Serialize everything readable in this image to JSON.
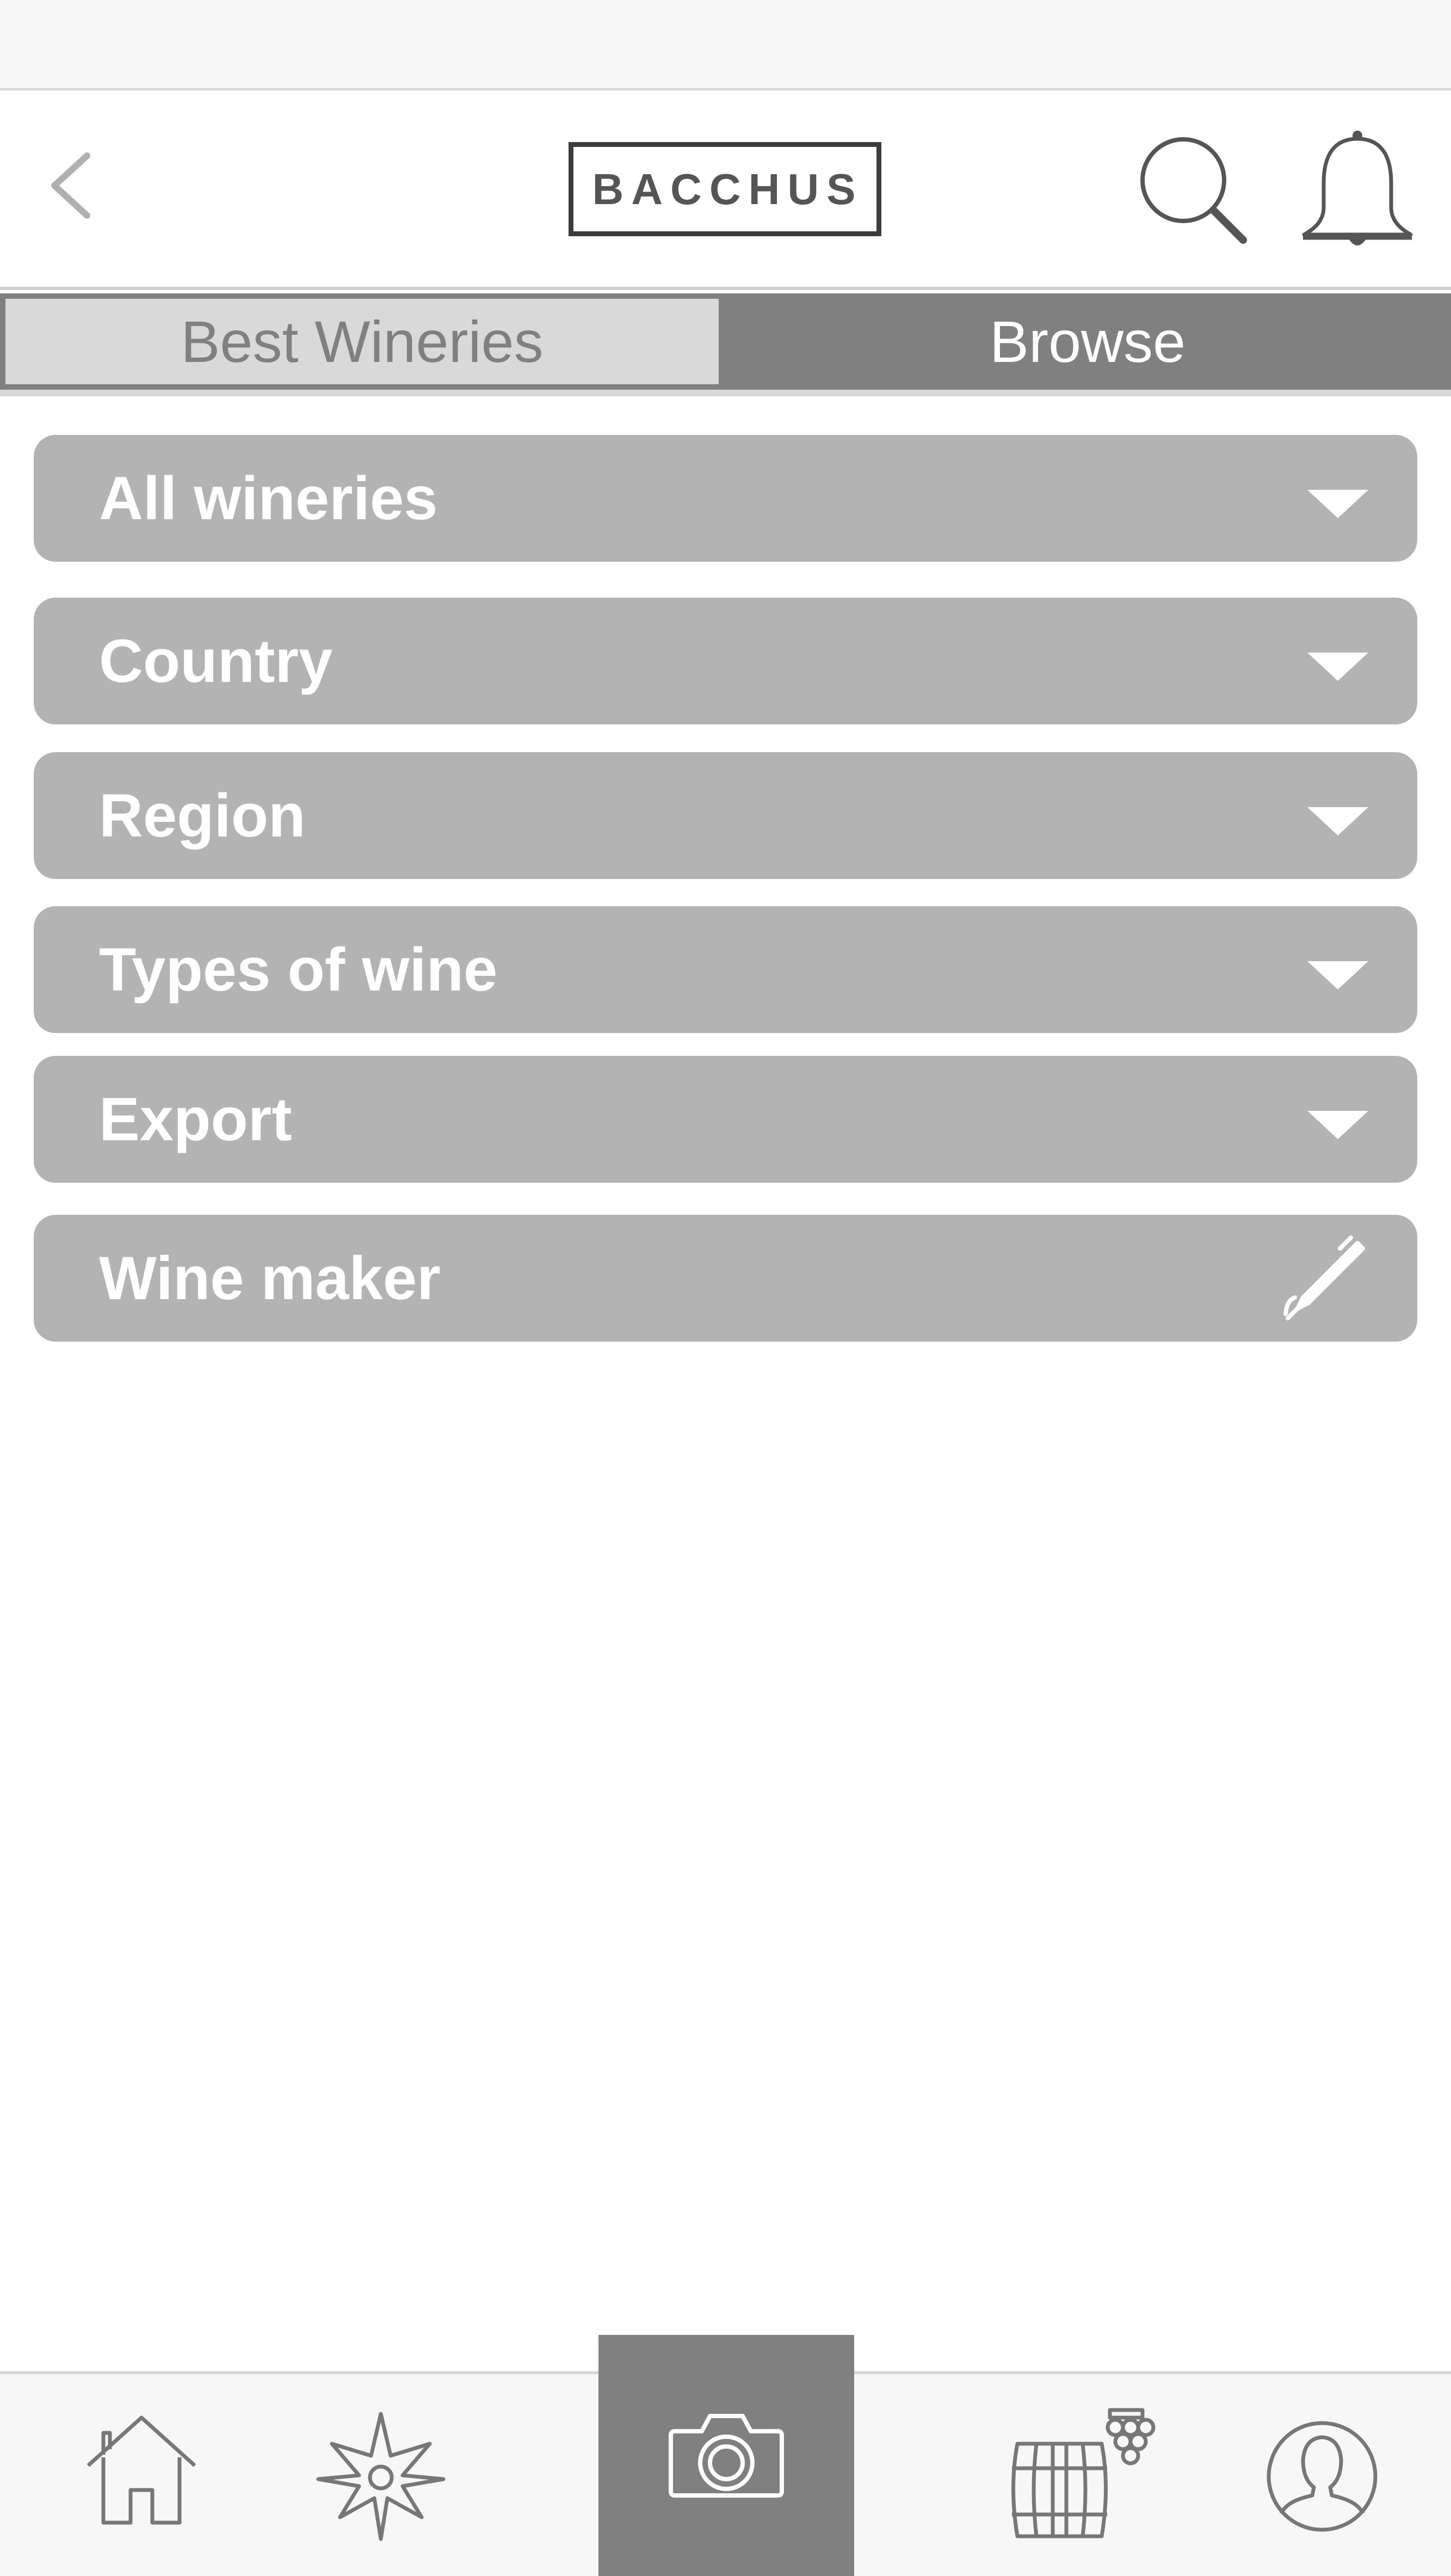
{
  "header": {
    "logo_text": "BACCHUS",
    "icons": {
      "back": "chevron-left-icon",
      "search": "search-icon",
      "notifications": "bell-icon"
    }
  },
  "tabs": [
    {
      "label": "Best Wineries",
      "selected": false
    },
    {
      "label": "Browse",
      "selected": true
    }
  ],
  "filters": [
    {
      "label": "All wineries",
      "icon": "chevron-down-icon"
    },
    {
      "label": "Country",
      "icon": "chevron-down-icon"
    },
    {
      "label": "Region",
      "icon": "chevron-down-icon"
    },
    {
      "label": "Types of wine",
      "icon": "chevron-down-icon"
    },
    {
      "label": "Export",
      "icon": "chevron-down-icon"
    },
    {
      "label": "Wine maker",
      "icon": "pen-icon"
    }
  ],
  "bottom_nav": {
    "items": [
      "home-icon",
      "compass-icon",
      "camera-icon",
      "wine-cellar-icon",
      "profile-icon"
    ],
    "active": "camera-icon"
  },
  "colors": {
    "accent": "#808080",
    "filter_bg": "#b3b3b3",
    "tab_inactive_bg": "#d9d9d9",
    "bar_bg": "#f7f7f7"
  }
}
